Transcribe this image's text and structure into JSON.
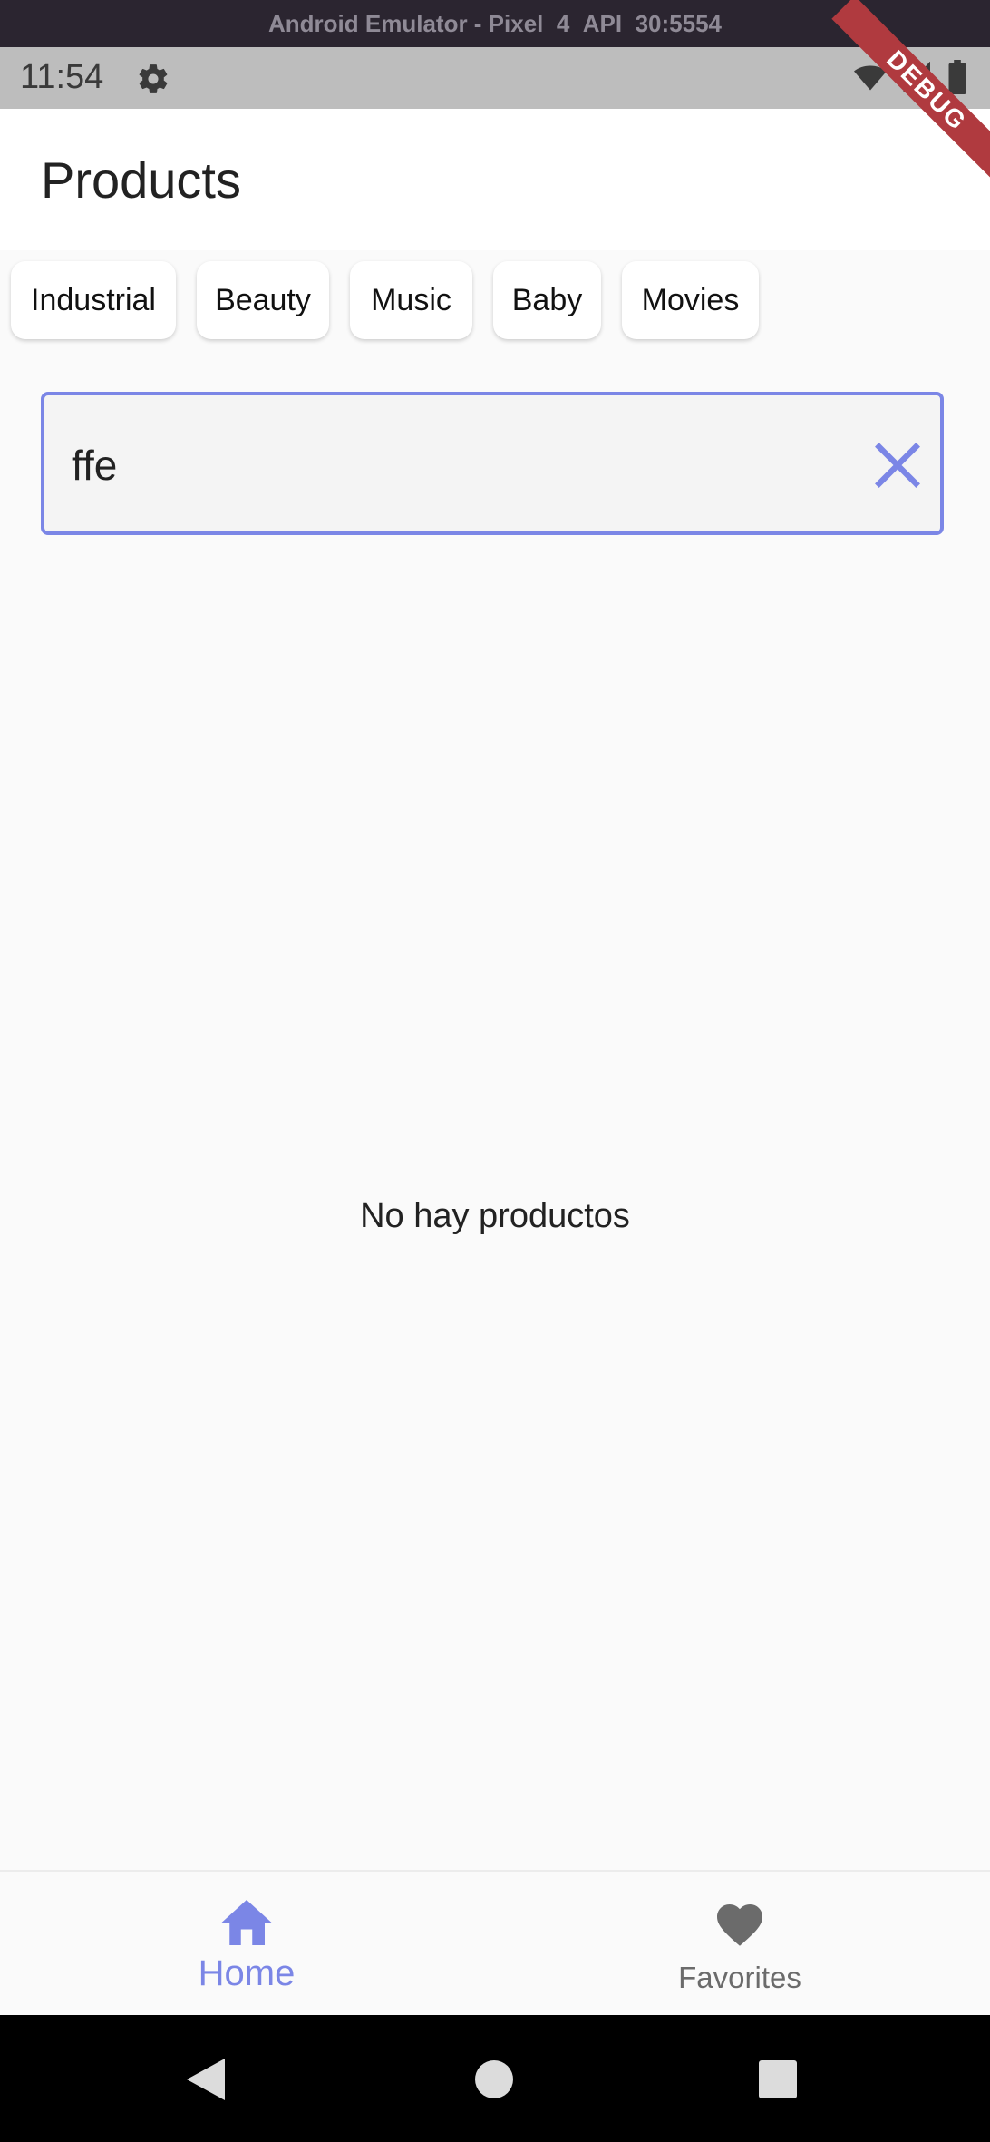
{
  "window": {
    "title": "Android Emulator - Pixel_4_API_30:5554"
  },
  "status_bar": {
    "time": "11:54",
    "icons": [
      "gear-icon",
      "wifi-icon",
      "cell-signal-icon",
      "battery-icon"
    ]
  },
  "debug_banner": {
    "label": "DEBUG",
    "color": "#b03a3f"
  },
  "app_bar": {
    "title": "Products"
  },
  "categories": [
    {
      "label": "Industrial"
    },
    {
      "label": "Beauty"
    },
    {
      "label": "Music"
    },
    {
      "label": "Baby"
    },
    {
      "label": "Movies"
    }
  ],
  "search": {
    "value": "ffe",
    "clear_icon": "close-icon"
  },
  "empty_state": {
    "message": "No hay productos"
  },
  "bottom_nav": {
    "selected": "Home",
    "items": [
      {
        "label": "Home",
        "icon": "home-icon"
      },
      {
        "label": "Favorites",
        "icon": "heart-icon"
      }
    ]
  },
  "colors": {
    "accent": "#7b86e6",
    "inactive": "#6b6b6b",
    "background": "#fafafa"
  }
}
